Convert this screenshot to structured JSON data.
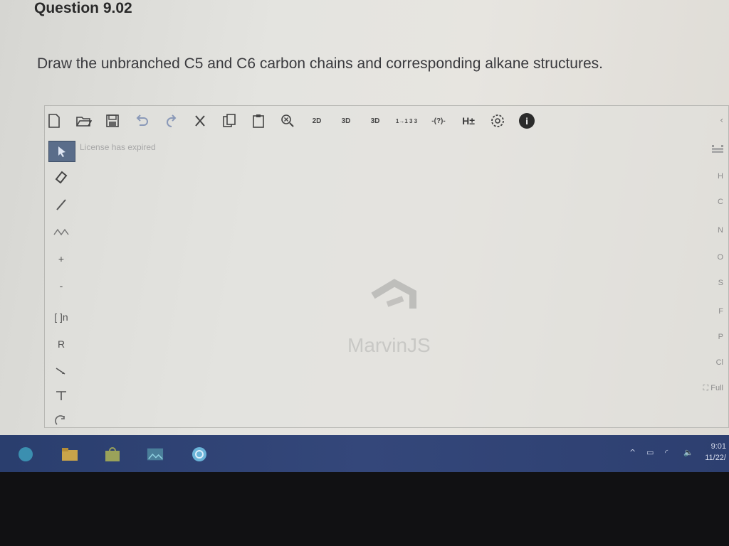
{
  "question": {
    "title": "Question 9.02",
    "prompt": "Draw the unbranched C5 and C6 carbon chains and corresponding alkane structures."
  },
  "toolbar": {
    "buttons": [
      {
        "name": "new-document-icon",
        "glyph": ""
      },
      {
        "name": "open-icon",
        "glyph": ""
      },
      {
        "name": "save-icon",
        "glyph": ""
      },
      {
        "name": "undo-icon",
        "glyph": "↶"
      },
      {
        "name": "redo-icon",
        "glyph": "↷"
      },
      {
        "name": "cut-icon",
        "glyph": "✕"
      },
      {
        "name": "copy-icon",
        "glyph": ""
      },
      {
        "name": "paste-icon",
        "glyph": ""
      },
      {
        "name": "zoom-icon",
        "glyph": ""
      },
      {
        "name": "clean-2d-icon",
        "label": "2D"
      },
      {
        "name": "clean-3d-icon",
        "label": "3D"
      },
      {
        "name": "view-3d-icon",
        "label": "3D"
      },
      {
        "name": "atom-map-icon",
        "label": "1→1 3 3"
      },
      {
        "name": "reaction-map-icon",
        "label": "-(?)-"
      },
      {
        "name": "hydrogen-toggle-icon",
        "label": "H±"
      },
      {
        "name": "settings-icon",
        "glyph": ""
      },
      {
        "name": "info-icon",
        "label": "i"
      }
    ]
  },
  "canvas": {
    "license_notice": "License has expired",
    "watermark_text": "MarvinJS"
  },
  "left_tools": [
    {
      "name": "select-tool-icon",
      "label": ""
    },
    {
      "name": "eraser-tool-icon",
      "label": ""
    },
    {
      "name": "single-bond-tool-icon",
      "label": ""
    },
    {
      "name": "chain-tool-icon",
      "label": ""
    },
    {
      "name": "charge-plus-tool-icon",
      "label": "+"
    },
    {
      "name": "charge-minus-tool-icon",
      "label": "-"
    },
    {
      "name": "bracket-tool-icon",
      "label": "[ ]n"
    },
    {
      "name": "r-group-tool-icon",
      "label": "R"
    },
    {
      "name": "reaction-arrow-tool-icon",
      "label": ""
    },
    {
      "name": "text-tool-icon",
      "label": ""
    },
    {
      "name": "rotate-tool-icon",
      "label": ""
    }
  ],
  "right_elements": [
    "H",
    "C",
    "N",
    "O",
    "S",
    "F",
    "P",
    "Cl"
  ],
  "right_extra": {
    "periodic": "",
    "full": "Full"
  },
  "taskbar": {
    "time": "9:01",
    "date": "11/22/",
    "apps": [
      "start-icon",
      "file-explorer-icon",
      "store-icon",
      "photos-icon",
      "edge-icon"
    ]
  },
  "colors": {
    "taskbar": "#2f4378",
    "bezel": "#111113",
    "screen": "#e2e2de"
  }
}
